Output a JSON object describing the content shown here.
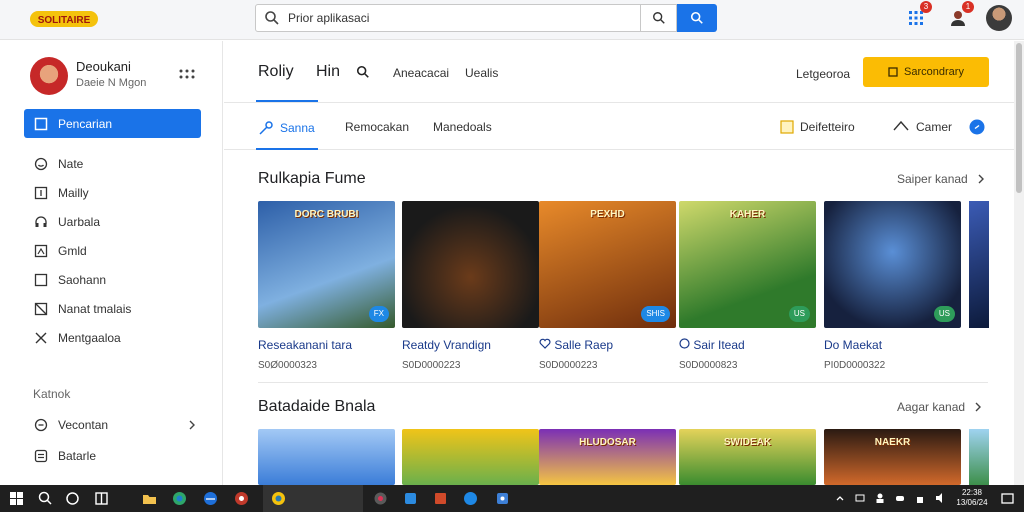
{
  "logo": {
    "text": "SOLITAIRE"
  },
  "search": {
    "value": "Prior aplikasaci",
    "placeholder": ""
  },
  "topbar": {
    "apps_badge": "3",
    "notif_badge": "1"
  },
  "profile": {
    "name": "Deoukani",
    "subtitle": "Daeie N Mgon"
  },
  "sidebar": {
    "items": [
      {
        "label": "Pencarian",
        "icon": "square-icon",
        "active": true
      },
      {
        "label": "Nate",
        "icon": "smile-icon"
      },
      {
        "label": "Mailly",
        "icon": "badge-icon"
      },
      {
        "label": "Uarbala",
        "icon": "headset-icon"
      },
      {
        "label": "Gmld",
        "icon": "bookmark-icon"
      },
      {
        "label": "Saohann",
        "icon": "square-outline-icon"
      },
      {
        "label": "Nanat tmalais",
        "icon": "slash-box-icon"
      },
      {
        "label": "Mentgaaloa",
        "icon": "close-icon"
      }
    ],
    "section_label": "Katnok",
    "items2": [
      {
        "label": "Vecontan",
        "icon": "headset-icon",
        "has_chevron": true
      },
      {
        "label": "Batarle",
        "icon": "list-icon"
      }
    ]
  },
  "tabs_top": {
    "t1": "Roliy",
    "t2": "Hin",
    "t3": "Aneacacai",
    "t4": "Uealis",
    "category_link": "Letgeoroa",
    "subscribe_label": "Sarcondrary"
  },
  "tabs_sub": {
    "t1": "Sanna",
    "t2": "Remocakan",
    "t3": "Manedoals",
    "right1": "Deifetteiro",
    "right2": "Camer"
  },
  "section1": {
    "title": "Rulkapia Fume",
    "link": "Saiper kanad",
    "cards": [
      {
        "thumb_text": "DORC BRUBI",
        "title": "Reseakanani tara",
        "sub": "S0Ø0000323",
        "chip": "FX",
        "palette": [
          "#2d5fa8",
          "#7fb0e0"
        ]
      },
      {
        "thumb_text": "",
        "title": "Reatdy Vrandign",
        "sub": "S0D0000223",
        "chip": "",
        "palette": [
          "#1a1a1a",
          "#6b3b1a"
        ]
      },
      {
        "thumb_text": "PEXHD",
        "title": "Salle Raep",
        "sub": "S0D0000223",
        "chip": "SHIS",
        "palette": [
          "#6e2d0c",
          "#e88a2a"
        ]
      },
      {
        "thumb_text": "KAHER",
        "title": "Sair Itead",
        "sub": "S0D0000823",
        "chip": "US",
        "palette": [
          "#2f7a2b",
          "#cfd96b"
        ]
      },
      {
        "thumb_text": "",
        "title": "Do Maekat",
        "sub": "PI0D0000322",
        "chip": "US",
        "palette": [
          "#16213e",
          "#5a8fd6"
        ]
      }
    ]
  },
  "section2": {
    "title": "Batadaide Bnala",
    "link": "Aagar kanad",
    "cards": [
      {
        "thumb_text": "",
        "palette": [
          "#3b7dd8",
          "#a3c9f5"
        ]
      },
      {
        "thumb_text": "",
        "palette": [
          "#6ab04c",
          "#f0c419"
        ]
      },
      {
        "thumb_text": "HLUDOSAR",
        "palette": [
          "#7b2fb5",
          "#f5c542"
        ]
      },
      {
        "thumb_text": "SWIDEAK",
        "palette": [
          "#3a8c2f",
          "#e4d35a"
        ]
      },
      {
        "thumb_text": "NAEKR",
        "palette": [
          "#2b1a12",
          "#d1692b"
        ]
      }
    ]
  },
  "taskbar": {
    "time": "22:38",
    "date": "13/06/24"
  },
  "colors": {
    "accent": "#1a73e8",
    "subscribe": "#fbbc04",
    "taskbar": "#1f1f1f"
  }
}
